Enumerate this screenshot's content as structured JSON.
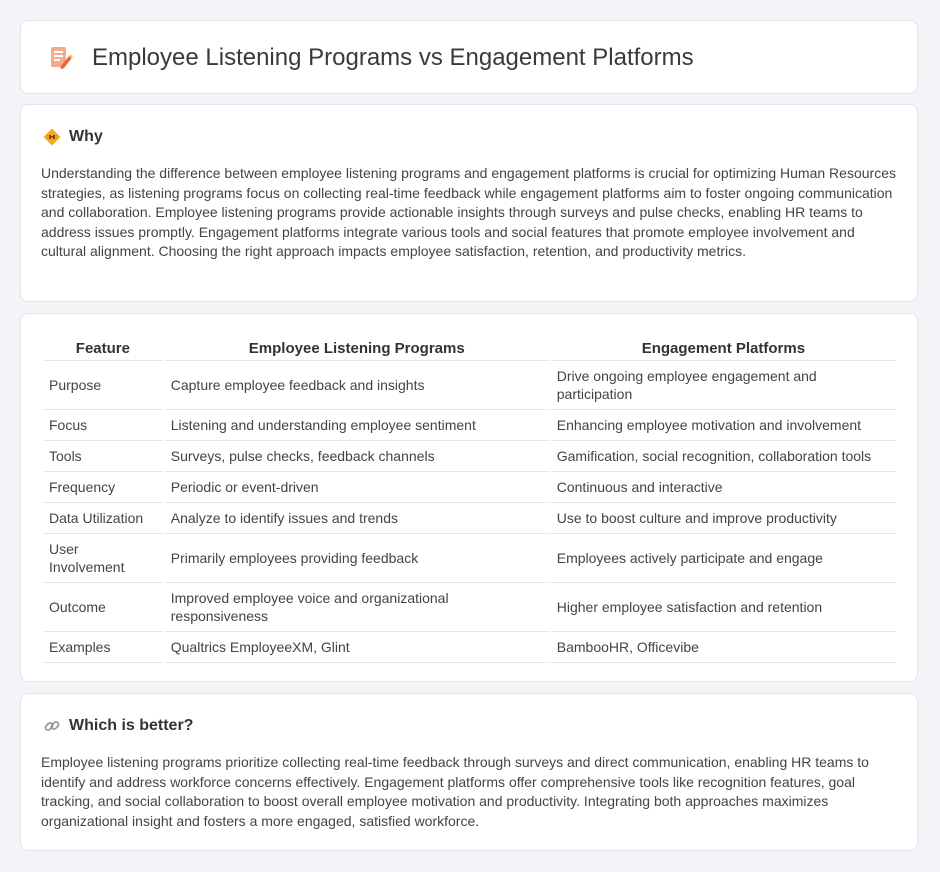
{
  "header": {
    "title": "Employee Listening Programs vs Engagement Platforms",
    "icon": "document-edit-icon"
  },
  "why": {
    "title": "Why",
    "icon": "diamond-sign-icon",
    "body": "Understanding the difference between employee listening programs and engagement platforms is crucial for optimizing Human Resources strategies, as listening programs focus on collecting real-time feedback while engagement platforms aim to foster ongoing communication and collaboration. Employee listening programs provide actionable insights through surveys and pulse checks, enabling HR teams to address issues promptly. Engagement platforms integrate various tools and social features that promote employee involvement and cultural alignment. Choosing the right approach impacts employee satisfaction, retention, and productivity metrics."
  },
  "table": {
    "headers": [
      "Feature",
      "Employee Listening Programs",
      "Engagement Platforms"
    ],
    "rows": [
      {
        "feature": "Purpose",
        "elp": "Capture employee feedback and insights",
        "ep": "Drive ongoing employee engagement and participation"
      },
      {
        "feature": "Focus",
        "elp": "Listening and understanding employee sentiment",
        "ep": "Enhancing employee motivation and involvement"
      },
      {
        "feature": "Tools",
        "elp": "Surveys, pulse checks, feedback channels",
        "ep": "Gamification, social recognition, collaboration tools"
      },
      {
        "feature": "Frequency",
        "elp": "Periodic or event-driven",
        "ep": "Continuous and interactive"
      },
      {
        "feature": "Data Utilization",
        "elp": "Analyze to identify issues and trends",
        "ep": "Use to boost culture and improve productivity"
      },
      {
        "feature": "User Involvement",
        "elp": "Primarily employees providing feedback",
        "ep": "Employees actively participate and engage"
      },
      {
        "feature": "Outcome",
        "elp": "Improved employee voice and organizational responsiveness",
        "ep": "Higher employee satisfaction and retention"
      },
      {
        "feature": "Examples",
        "elp": "Qualtrics EmployeeXM, Glint",
        "ep": "BambooHR, Officevibe"
      }
    ]
  },
  "which": {
    "title": "Which is better?",
    "icon": "link-icon",
    "body": "Employee listening programs prioritize collecting real-time feedback through surveys and direct communication, enabling HR teams to identify and address workforce concerns effectively. Engagement platforms offer comprehensive tools like recognition features, goal tracking, and social collaboration to boost overall employee motivation and productivity. Integrating both approaches maximizes organizational insight and fosters a more engaged, satisfied workforce."
  }
}
